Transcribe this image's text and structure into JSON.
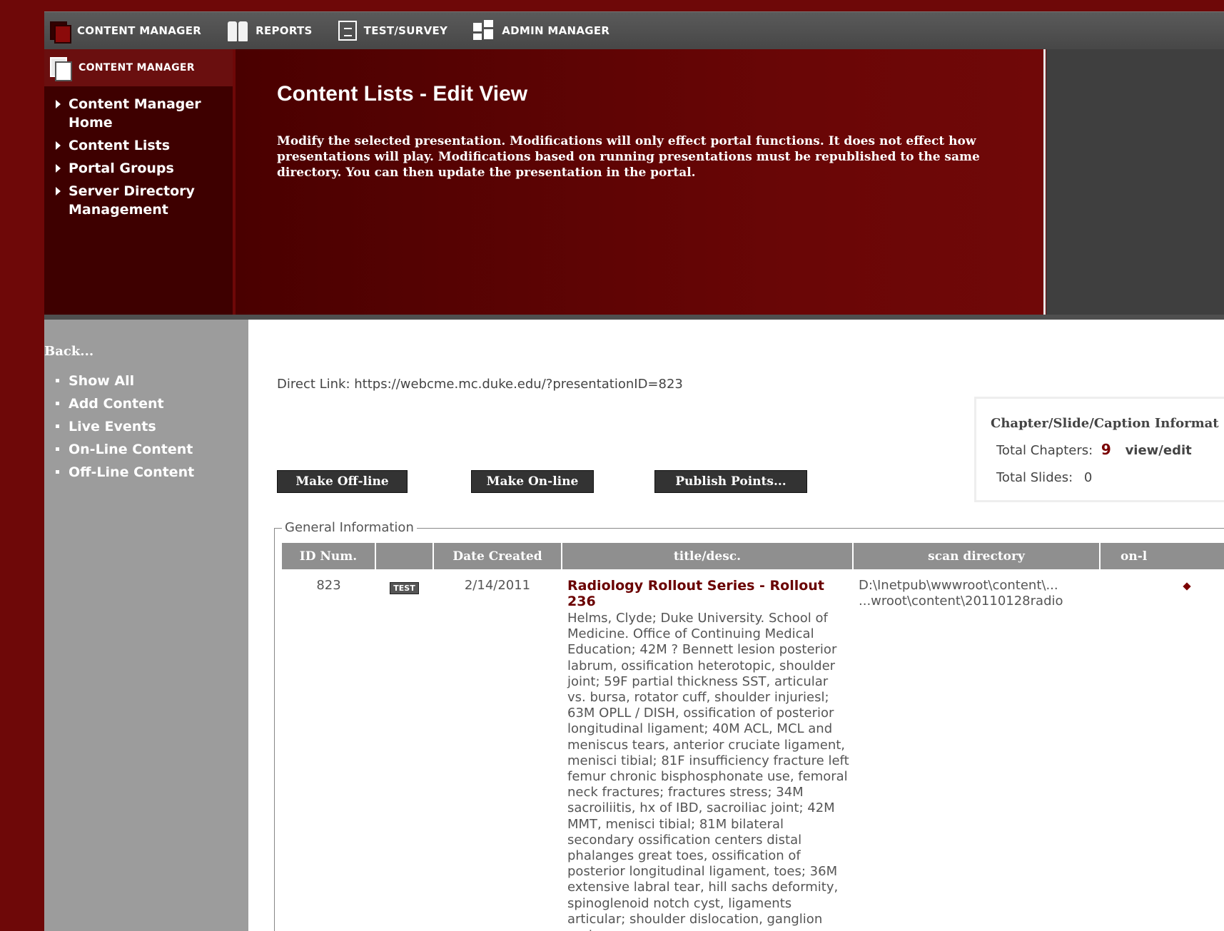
{
  "topnav": {
    "items": [
      {
        "label": "CONTENT MANAGER"
      },
      {
        "label": "REPORTS"
      },
      {
        "label": "TEST/SURVEY"
      },
      {
        "label": "ADMIN MANAGER"
      }
    ]
  },
  "cm_panel": {
    "title": "CONTENT MANAGER",
    "items": [
      {
        "label": "Content Manager Home"
      },
      {
        "label": "Content Lists"
      },
      {
        "label": "Portal Groups"
      },
      {
        "label": "Server Directory Management"
      }
    ]
  },
  "banner": {
    "title": "Content Lists - Edit View",
    "description": "Modify the selected presentation. Modifications will only effect portal functions. It does not effect how presentations will play. Modifications based on running presentations must be republished to the same directory. You can then update the presentation in the portal."
  },
  "sidebar": {
    "back_label": "Back...",
    "links": [
      {
        "label": "Show All"
      },
      {
        "label": "Add Content"
      },
      {
        "label": "Live Events"
      },
      {
        "label": "On-Line Content"
      },
      {
        "label": "Off-Line Content"
      }
    ]
  },
  "main": {
    "direct_link": "Direct Link: https://webcme.mc.duke.edu/?presentationID=823",
    "buttons": {
      "make_offline": "Make Off-line",
      "make_online": "Make On-line",
      "publish_points": "Publish Points..."
    },
    "chapter_info": {
      "title": "Chapter/Slide/Caption Informat",
      "total_chapters_label": "Total Chapters:",
      "total_chapters": "9",
      "view_edit": "view/edit",
      "total_slides_label": "Total Slides:",
      "total_slides": "0"
    },
    "general_info": {
      "legend": "General Information",
      "columns": [
        "ID Num.",
        "",
        "Date Created",
        "title/desc.",
        "scan directory",
        "on-l"
      ],
      "row": {
        "id": "823",
        "badge": "TEST",
        "date": "2/14/2011",
        "title": "Radiology Rollout Series - Rollout 236",
        "description": "Helms, Clyde; Duke University. School of Medicine. Office of Continuing Medical Education; 42M ? Bennett lesion posterior labrum, ossification heterotopic, shoulder joint; 59F partial thickness SST, articular vs. bursa, rotator cuff, shoulder injuriesl; 63M OPLL / DISH, ossification of posterior longitudinal ligament; 40M ACL, MCL and meniscus tears, anterior cruciate ligament, menisci tibial; 81F insufficiency fracture left femur chronic bisphosphonate use, femoral neck fractures; fractures stress; 34M sacroiliitis, hx of IBD, sacroiliac joint; 42M MMT, menisci tibial; 81M bilateral secondary ossification centers distal phalanges great toes, ossification of posterior longitudinal ligament, toes; 36M extensive labral tear, hill sachs deformity, spinoglenoid notch cyst, ligaments articular; shoulder dislocation, ganglion cysts;",
        "scan_dir_line1": "D:\\Inetpub\\wwwroot\\content\\...",
        "scan_dir_line2": "...wroot\\content\\20110128radio"
      }
    }
  }
}
